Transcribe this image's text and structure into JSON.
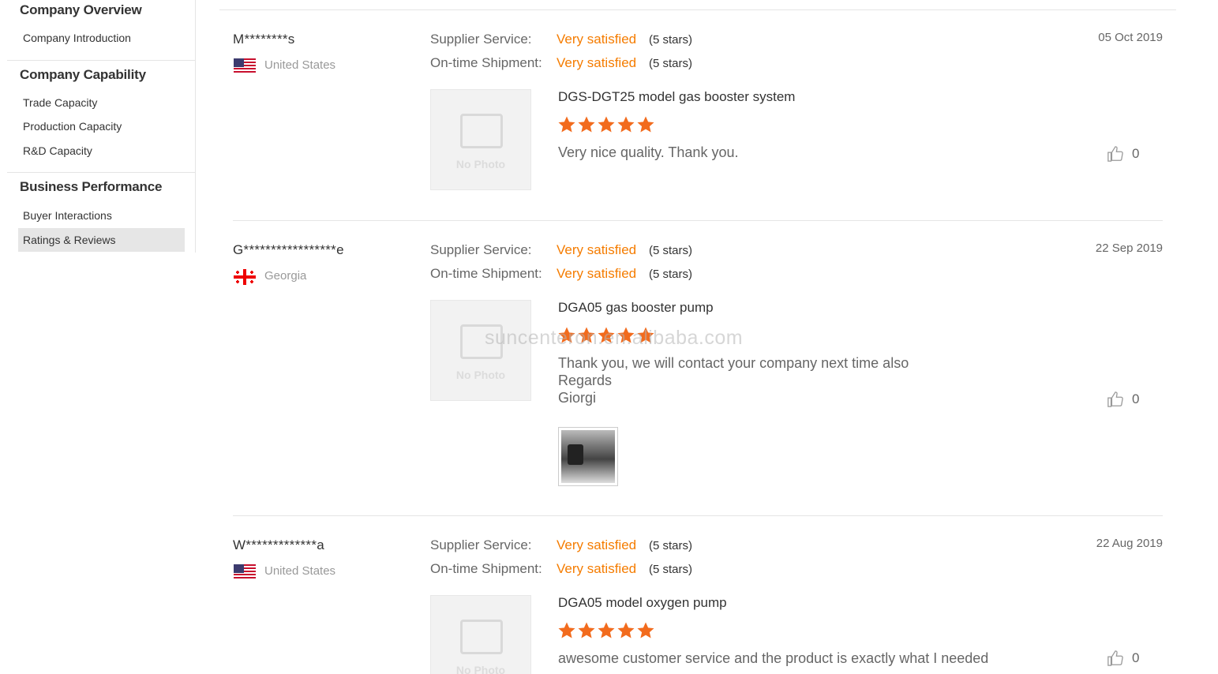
{
  "sidebar": {
    "groups": [
      {
        "title": "Company Overview",
        "items": [
          "Company Introduction"
        ]
      },
      {
        "title": "Company Capability",
        "items": [
          "Trade Capacity",
          "Production Capacity",
          "R&D Capacity"
        ]
      },
      {
        "title": "Business Performance",
        "items": [
          "Buyer Interactions",
          "Ratings & Reviews"
        ]
      }
    ],
    "active_item": "Ratings & Reviews"
  },
  "rating_labels": {
    "supplier_service": "Supplier Service:",
    "ontime_shipment": "On-time Shipment:"
  },
  "no_photo_text": "No Photo",
  "watermark": "suncenteron.en.alibaba.com",
  "colors": {
    "accent": "#f57c00",
    "star": "#f26b1d"
  },
  "reviews": [
    {
      "buyer": "M********s",
      "country": "United States",
      "flag": "us-flag-icon",
      "supplier_service": "Very satisfied",
      "supplier_service_stars": "(5 stars)",
      "shipment": "Very satisfied",
      "shipment_stars": "(5 stars)",
      "date": "05 Oct 2019",
      "product": "DGS-DGT25 model gas booster system",
      "rating": 5,
      "text": "Very nice quality.  Thank you.",
      "likes": "0"
    },
    {
      "buyer": "G*****************e",
      "country": "Georgia",
      "flag": "georgia-flag-icon",
      "supplier_service": "Very satisfied",
      "supplier_service_stars": "(5 stars)",
      "shipment": "Very satisfied",
      "shipment_stars": "(5 stars)",
      "date": "22 Sep 2019",
      "product": "DGA05 gas booster pump",
      "rating": 5,
      "text": "Thank you, we will contact your company next time also\nRegards\nGiorgi",
      "likes": "0",
      "has_attachment": true
    },
    {
      "buyer": "W*************a",
      "country": "United States",
      "flag": "us-flag-icon",
      "supplier_service": "Very satisfied",
      "supplier_service_stars": "(5 stars)",
      "shipment": "Very satisfied",
      "shipment_stars": "(5 stars)",
      "date": "22 Aug 2019",
      "product": "DGA05 model oxygen pump",
      "rating": 5,
      "text": "awesome customer service and the product is exactly what I needed",
      "likes": "0"
    }
  ]
}
